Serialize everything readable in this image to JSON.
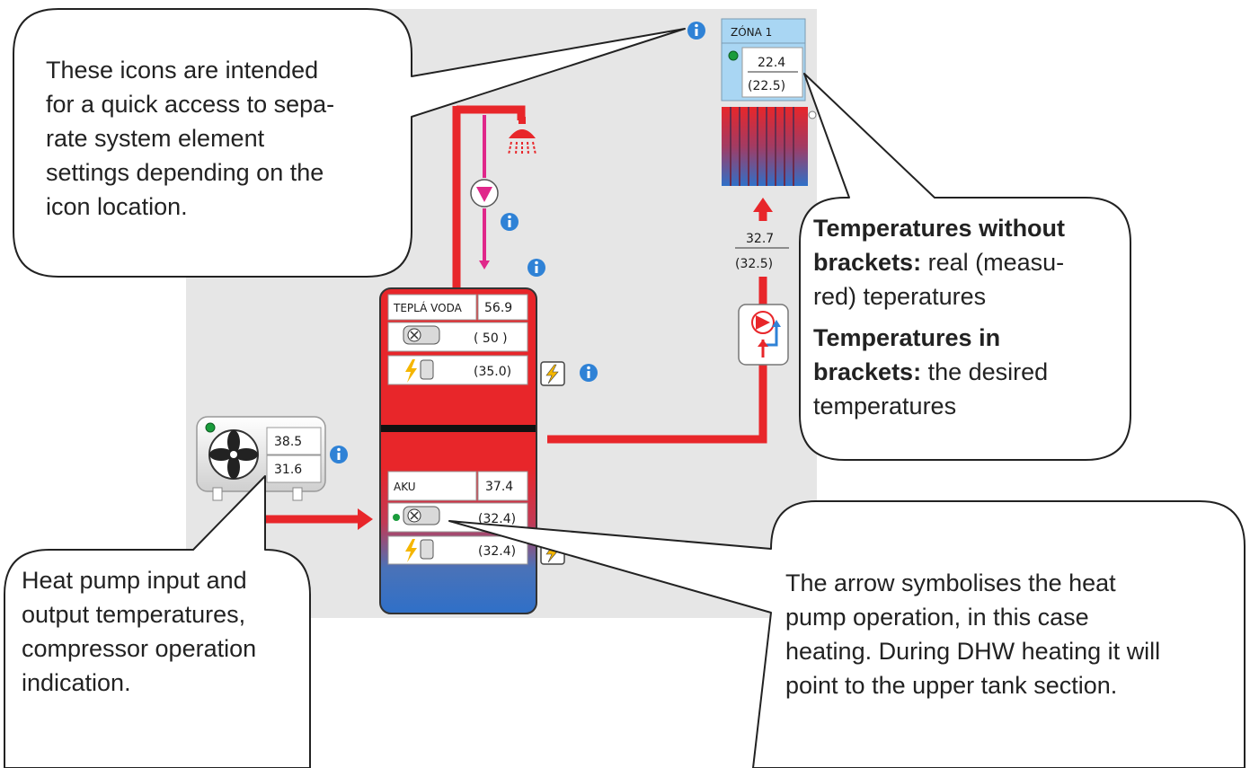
{
  "zone": {
    "title": "ZÓNA 1",
    "actual": "22.4",
    "desired": "(22.5)"
  },
  "flow": {
    "actual": "32.7",
    "desired": "(32.5)"
  },
  "dhw": {
    "label": "TEPLÁ VODA",
    "temp": "56.9",
    "heater_setpoint": "( 50 )",
    "electric_setpoint": "(35.0)"
  },
  "aku": {
    "label": "AKU",
    "temp": "37.4",
    "heater_setpoint": "(32.4)",
    "electric_setpoint": "(32.4)"
  },
  "heat_pump": {
    "output_temp": "38.5",
    "input_temp": "31.6"
  },
  "callouts": {
    "icons": [
      "These icons are intended",
      "for a quick access to sepa-",
      "rate system element",
      "settings depending on the",
      "icon location."
    ],
    "temps": {
      "line1_bold": "Temperatures without",
      "line2_bold": "brackets:",
      "line2_rest": " real (measu-",
      "line3": "red) teperatures",
      "line4_bold": "Temperatures in",
      "line5_bold": "brackets:",
      "line5_rest": " the desired",
      "line6": "temperatures"
    },
    "heat_pump": [
      "Heat pump input and",
      "output temperatures,",
      "compressor operation",
      "indication."
    ],
    "arrow": [
      "The arrow symbolises the heat",
      "pump operation, in this case",
      "heating. During DHW heating it will",
      "point to the upper tank section."
    ]
  },
  "colors": {
    "pipe": "#e8262a",
    "info": "#2f82d6",
    "zone_bg": "#a9d6f3",
    "bg": "#e6e6e6",
    "circulation": "#e0278a"
  }
}
